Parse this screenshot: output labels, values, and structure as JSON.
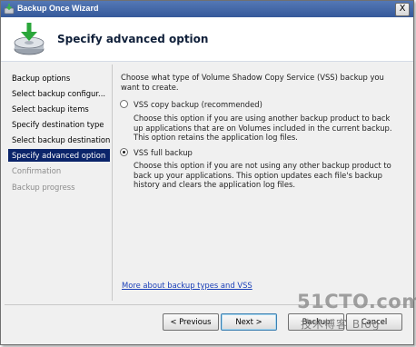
{
  "window": {
    "title": "Backup Once Wizard",
    "close_label": "X"
  },
  "header": {
    "title": "Specify advanced option"
  },
  "nav": {
    "items": [
      {
        "label": "Backup options",
        "state": "normal"
      },
      {
        "label": "Select backup configur...",
        "state": "normal"
      },
      {
        "label": "Select backup items",
        "state": "normal"
      },
      {
        "label": "Specify destination type",
        "state": "normal"
      },
      {
        "label": "Select backup destination",
        "state": "normal"
      },
      {
        "label": "Specify advanced option",
        "state": "active"
      },
      {
        "label": "Confirmation",
        "state": "disabled"
      },
      {
        "label": "Backup progress",
        "state": "disabled"
      }
    ]
  },
  "content": {
    "intro": "Choose what type of Volume Shadow Copy Service (VSS) backup you want to create.",
    "options": [
      {
        "label": "VSS copy backup (recommended)",
        "checked": false,
        "description": "Choose this option if you are using another backup product to back up applications that are on Volumes included in the current backup. This option retains the application log files."
      },
      {
        "label": "VSS full backup",
        "checked": true,
        "description": "Choose this option if you are not using any other backup product to back up your applications. This option updates each file's backup history and clears the application log files."
      }
    ],
    "link": "More about backup types and VSS"
  },
  "buttons": {
    "previous": "< Previous",
    "next": "Next >",
    "backup": "Backup",
    "cancel": "Cancel"
  },
  "watermark": {
    "main": "51CTO.com",
    "sub": "技术博客 Blog"
  },
  "colors": {
    "title_bar": "#35599a",
    "nav_active": "#0a246a",
    "link": "#1a3fb8"
  }
}
